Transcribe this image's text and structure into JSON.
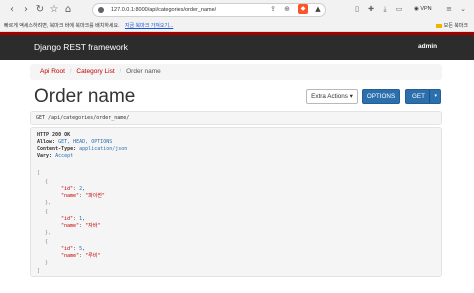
{
  "browser": {
    "url": "127.0.0.1:8000/api/categories/order_name/",
    "vpn_label": "VPN",
    "infobar_text": "빠르게 액세스하려면, 북마크 바에 북마크를 배치하세요.",
    "infobar_link": "지금 북마크 가져오기...",
    "bookmark_folder": "모든 북마크"
  },
  "navbar": {
    "brand": "Django REST framework",
    "user": "admin"
  },
  "breadcrumb": {
    "items": [
      "Api Root",
      "Category List",
      "Order name"
    ]
  },
  "page": {
    "title": "Order name"
  },
  "buttons": {
    "extra_actions": "Extra Actions ▾",
    "options": "OPTIONS",
    "get": "GET",
    "get_caret": "▾"
  },
  "request": {
    "line": "GET /api/categories/order_name/"
  },
  "response": {
    "status": "HTTP 200 OK",
    "headers": [
      {
        "key": "Allow:",
        "value": "GET, HEAD, OPTIONS"
      },
      {
        "key": "Content-Type:",
        "value": "application/json"
      },
      {
        "key": "Vary:",
        "value": "Accept"
      }
    ],
    "body": [
      {
        "id": "2",
        "name": "\"파이썬\""
      },
      {
        "id": "1",
        "name": "\"자바\""
      },
      {
        "id": "5",
        "name": "\"루비\""
      }
    ]
  }
}
